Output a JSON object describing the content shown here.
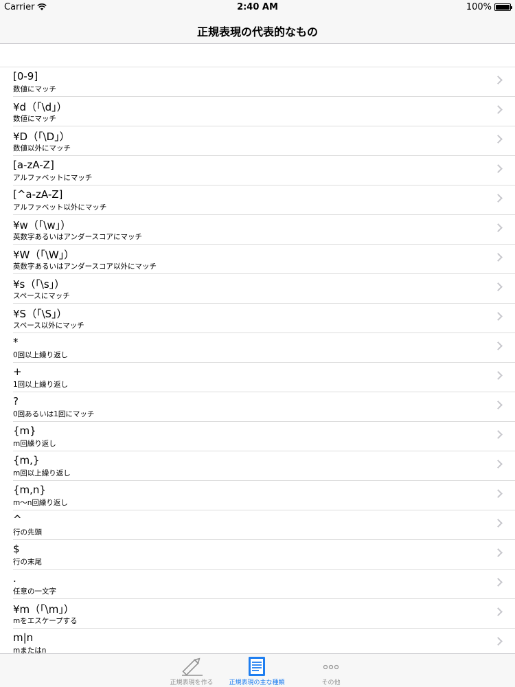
{
  "status_bar": {
    "carrier": "Carrier",
    "time": "2:40 AM",
    "battery": "100%"
  },
  "nav": {
    "title": "正規表現の代表的なもの"
  },
  "items": [
    {
      "title": "[0-9]",
      "subtitle": "数値にマッチ"
    },
    {
      "title": "¥d（「\\d」）",
      "subtitle": "数値にマッチ"
    },
    {
      "title": "¥D（「\\D」）",
      "subtitle": "数値以外にマッチ"
    },
    {
      "title": "[a-zA-Z]",
      "subtitle": "アルファベットにマッチ"
    },
    {
      "title": "[^a-zA-Z]",
      "subtitle": "アルファベット以外にマッチ"
    },
    {
      "title": "¥w（「\\w」）",
      "subtitle": "英数字あるいはアンダースコアにマッチ"
    },
    {
      "title": "¥W（「\\W」）",
      "subtitle": "英数字あるいはアンダースコア以外にマッチ"
    },
    {
      "title": "¥s（「\\s」）",
      "subtitle": "スペースにマッチ"
    },
    {
      "title": "¥S（「\\S」）",
      "subtitle": "スペース以外にマッチ"
    },
    {
      "title": "*",
      "subtitle": "0回以上繰り返し"
    },
    {
      "title": "+",
      "subtitle": "1回以上繰り返し"
    },
    {
      "title": "?",
      "subtitle": "0回あるいは1回にマッチ"
    },
    {
      "title": "{m}",
      "subtitle": "m回繰り返し"
    },
    {
      "title": "{m,}",
      "subtitle": "m回以上繰り返し"
    },
    {
      "title": "{m,n}",
      "subtitle": "m〜n回繰り返し"
    },
    {
      "title": "^",
      "subtitle": "行の先頭"
    },
    {
      "title": "$",
      "subtitle": "行の末尾"
    },
    {
      "title": ".",
      "subtitle": "任意の一文字"
    },
    {
      "title": "¥m（「\\m」）",
      "subtitle": "mをエスケープする"
    },
    {
      "title": "m|n",
      "subtitle": "mまたはn"
    }
  ],
  "tabs": [
    {
      "label": "正規表現を作る",
      "icon": "pencil-icon",
      "active": false
    },
    {
      "label": "正規表現の主な種類",
      "icon": "document-icon",
      "active": true
    },
    {
      "label": "その他",
      "icon": "more-icon",
      "active": false
    }
  ],
  "colors": {
    "accent": "#1e7ef0",
    "inactive": "#929292",
    "separator": "#dcdcdc"
  }
}
